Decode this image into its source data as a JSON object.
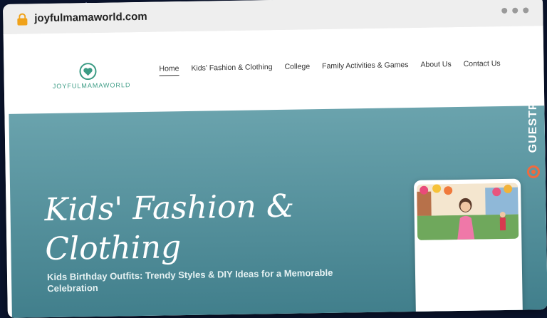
{
  "browser": {
    "url": "joyfulmamaworld.com"
  },
  "site": {
    "logo_text": "JOYFULMAMAWORLD"
  },
  "nav": {
    "items": [
      {
        "label": "Home",
        "active": true
      },
      {
        "label": "Kids' Fashion & Clothing",
        "active": false
      },
      {
        "label": "College",
        "active": false
      },
      {
        "label": "Family Activities & Games",
        "active": false
      },
      {
        "label": "About Us",
        "active": false
      },
      {
        "label": "Contact Us",
        "active": false
      }
    ]
  },
  "hero": {
    "title": "Kids' Fashion & Clothing",
    "subtitle": "Kids Birthday Outfits: Trendy Styles & DIY Ideas for a Memorable Celebration"
  },
  "watermark": {
    "text": "GUESTPOSTLINKS"
  },
  "colors": {
    "hero_top": "#6aa3ad",
    "hero_bottom": "#3f7d8a",
    "logo_green": "#3b9b84",
    "lock": "#f0a21a",
    "brand_orange": "#f06a3e"
  }
}
